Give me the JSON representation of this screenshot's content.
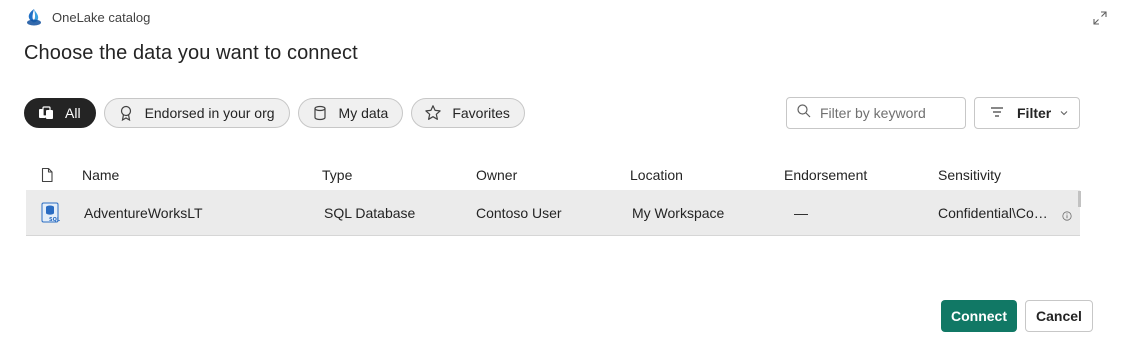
{
  "header": {
    "app_title": "OneLake catalog"
  },
  "dialog": {
    "title": "Choose the data you want to connect"
  },
  "pills": [
    {
      "label": "All",
      "icon": "stacked-items-icon",
      "active": true
    },
    {
      "label": "Endorsed in your org",
      "icon": "ribbon-icon"
    },
    {
      "label": "My data",
      "icon": "database-icon"
    },
    {
      "label": "Favorites",
      "icon": "star-icon"
    }
  ],
  "search": {
    "placeholder": "Filter by keyword",
    "value": ""
  },
  "filter": {
    "label": "Filter"
  },
  "table": {
    "columns": [
      "Name",
      "Type",
      "Owner",
      "Location",
      "Endorsement",
      "Sensitivity"
    ],
    "rows": [
      {
        "icon": "sql-database-icon",
        "name": "AdventureWorksLT",
        "type": "SQL Database",
        "owner": "Contoso User",
        "location": "My Workspace",
        "endorsement": "—",
        "sensitivity": "Confidential\\Contoso"
      }
    ]
  },
  "actions": {
    "connect": "Connect",
    "cancel": "Cancel"
  },
  "colors": {
    "primary": "#117865",
    "active_pill": "#242424",
    "row_bg": "#ebebeb",
    "logo_blue": "#1f6fc5"
  }
}
